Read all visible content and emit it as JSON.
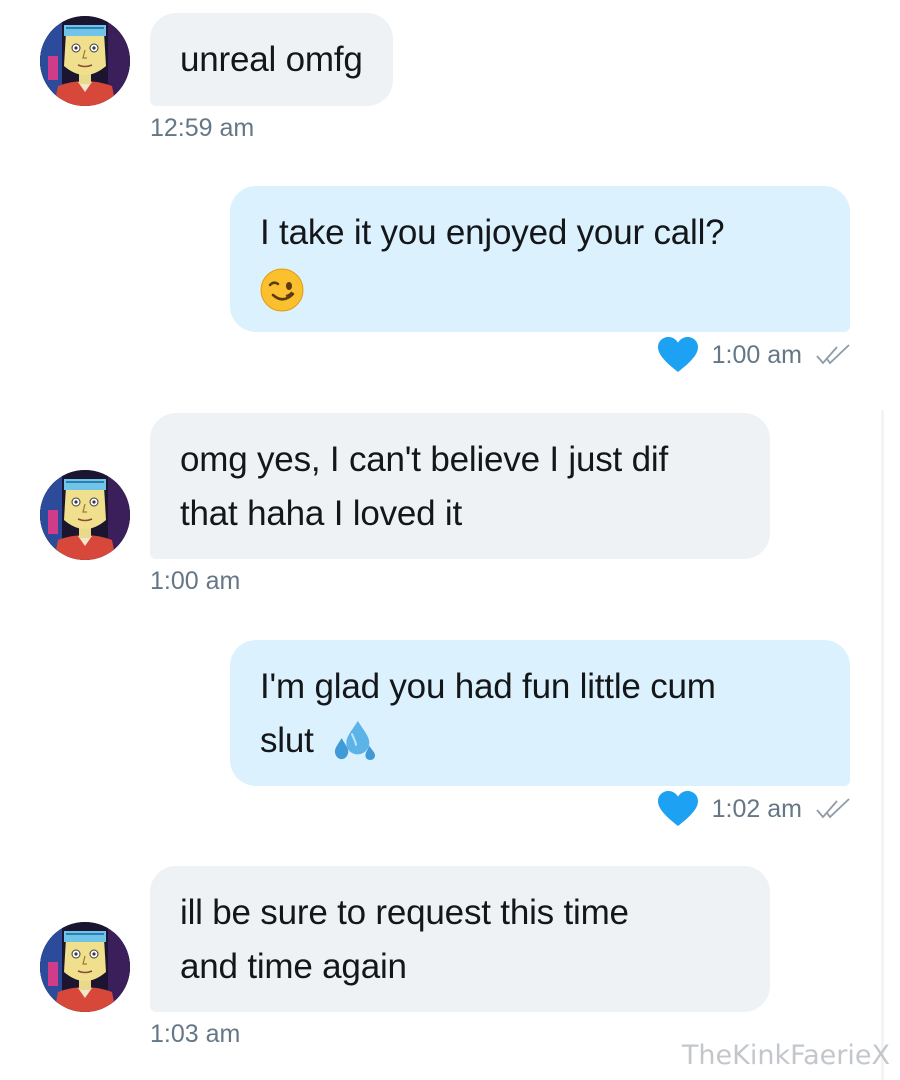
{
  "messages": [
    {
      "direction": "incoming",
      "lines": [
        "unreal omfg"
      ],
      "time": "12:59 am"
    },
    {
      "direction": "outgoing",
      "lines": [
        "I take it you enjoyed your call?"
      ],
      "emoji": "winking-face-emoji",
      "time": "1:00 am",
      "liked": true,
      "read": true
    },
    {
      "direction": "incoming",
      "lines": [
        "omg yes, I can't believe I just dif",
        "that haha I loved it"
      ],
      "time": "1:00 am"
    },
    {
      "direction": "outgoing",
      "lines": [
        "I'm glad you had fun little cum",
        "slut"
      ],
      "emoji": "sweat-droplets-emoji",
      "time": "1:02 am",
      "liked": true,
      "read": true
    },
    {
      "direction": "incoming",
      "lines": [
        "ill be sure to request this time",
        "and time again"
      ],
      "time": "1:03 am"
    }
  ],
  "watermark": "TheKinkFaerieX",
  "colors": {
    "incoming_bubble": "#eff2f5",
    "outgoing_bubble": "#dbf1fd",
    "heart": "#1da1f2",
    "timestamp": "#657786"
  },
  "icons": {
    "like": "heart-icon",
    "read_receipt": "double-check-icon",
    "avatar": "cartoon-portrait-avatar"
  }
}
